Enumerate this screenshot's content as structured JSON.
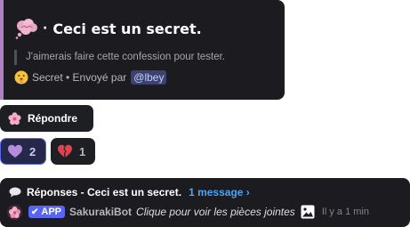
{
  "embed": {
    "title_separator": "·",
    "title": "Ceci est un secret.",
    "quote": "J'aimerais faire cette confession pour tester.",
    "footer_prefix": "Secret • Envoyé par",
    "mention": "@lbey",
    "accent_color": "#b07fc4"
  },
  "reply_button": {
    "label": "Répondre",
    "icon": "flower-icon"
  },
  "reactions": [
    {
      "icon": "purple-heart-icon",
      "count": "2",
      "selected": true
    },
    {
      "icon": "broken-heart-icon",
      "count": "1",
      "selected": false
    }
  ],
  "thread": {
    "title": "Réponses - Ceci est un secret.",
    "count": "1 message ›",
    "app_badge": "APP",
    "bot_name": "SakurakiBot",
    "attachment_text": "Clique pour voir les pièces jointes",
    "time": "Il y a 1 min"
  }
}
